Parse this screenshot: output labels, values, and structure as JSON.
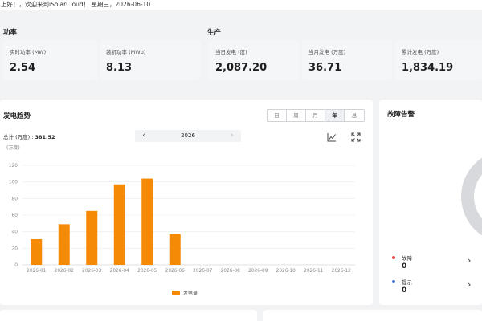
{
  "greeting": "上好！，欢迎来到iSolarCloud！ 星期三，2026-06-10",
  "power": {
    "title": "功率",
    "realtime": {
      "label": "实时功率 (MW)",
      "value": "2.54"
    },
    "installed": {
      "label": "装机功率 (MWp)",
      "value": "8.13"
    }
  },
  "generation": {
    "title": "生产",
    "today": {
      "label": "当日发电 (度)",
      "value": "2,087.20"
    },
    "month": {
      "label": "当月发电 (万度)",
      "value": "36.71"
    },
    "total": {
      "label": "累计发电 (万度)",
      "value": "1,834.19"
    }
  },
  "trend": {
    "title": "发电趋势",
    "tabs": [
      "日",
      "周",
      "月",
      "年",
      "总"
    ],
    "active_tab": "年",
    "total_label": "总计 (万度) :",
    "total_value": "381.52",
    "unit": "(万度)",
    "year": "2026",
    "prev_icon": "chevron-left-icon",
    "next_icon": "chevron-right-icon",
    "icons": [
      "line-chart-icon",
      "fullscreen-icon"
    ]
  },
  "alarm": {
    "title": "故障告警",
    "items": [
      {
        "name": "故障",
        "value": "0",
        "color": "#e84a4a"
      },
      {
        "name": "提示",
        "value": "0",
        "color": "#3a6fd8"
      }
    ]
  },
  "colors": {
    "bar": "#f58a07",
    "background": "#f2f3f5"
  },
  "chart_data": {
    "type": "bar",
    "categories": [
      "2026-01",
      "2026-02",
      "2026-03",
      "2026-04",
      "2026-05",
      "2026-06",
      "2026-07",
      "2026-08",
      "2026-09",
      "2026-10",
      "2026-11",
      "2026-12"
    ],
    "series": [
      {
        "name": "发电量",
        "values": [
          31,
          49,
          65,
          97,
          104,
          37,
          null,
          null,
          null,
          null,
          null,
          null
        ]
      }
    ],
    "ylim": [
      0,
      120
    ],
    "yticks": [
      0,
      20,
      40,
      60,
      80,
      100,
      120
    ],
    "ylabel": "(万度)",
    "grid": true,
    "legend": "bottom-center"
  }
}
